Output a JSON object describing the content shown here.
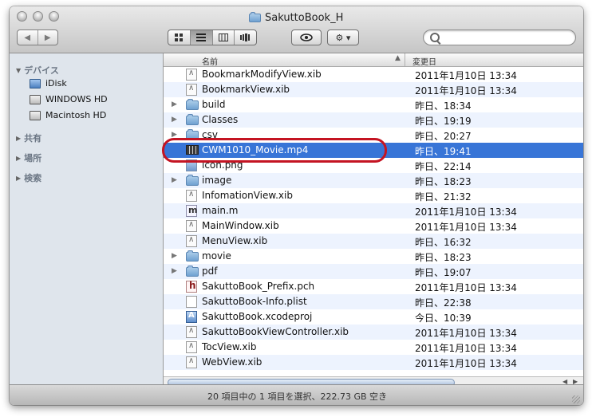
{
  "window": {
    "title": "SakuttoBook_H"
  },
  "toolbar": {
    "back_label": "◀",
    "forward_label": "▶",
    "view_modes": [
      "icon-view",
      "list-view",
      "column-view",
      "coverflow-view"
    ],
    "active_view": "list-view",
    "quicklook_label": "👁",
    "action_label": "⚙ ▾",
    "search_placeholder": ""
  },
  "sidebar": {
    "sections": [
      {
        "label": "デバイス",
        "expanded": true
      },
      {
        "label": "共有",
        "expanded": false
      },
      {
        "label": "場所",
        "expanded": false
      },
      {
        "label": "検索",
        "expanded": false
      }
    ],
    "devices": [
      {
        "label": "iDisk",
        "icon": "idisk-icon"
      },
      {
        "label": "WINDOWS HD",
        "icon": "hard-drive-icon"
      },
      {
        "label": "Macintosh HD",
        "icon": "hard-drive-icon"
      }
    ]
  },
  "columns": {
    "name": "名前",
    "modified": "変更日"
  },
  "files": [
    {
      "name": "BookmarkModifyView.xib",
      "date": "2011年1月10日 13:34",
      "type": "xib",
      "folder": false
    },
    {
      "name": "BookmarkView.xib",
      "date": "2011年1月10日 13:34",
      "type": "xib",
      "folder": false
    },
    {
      "name": "build",
      "date": "昨日、18:34",
      "type": "fold",
      "folder": true
    },
    {
      "name": "Classes",
      "date": "昨日、19:19",
      "type": "fold",
      "folder": true
    },
    {
      "name": "csv",
      "date": "昨日、20:27",
      "type": "fold",
      "folder": true
    },
    {
      "name": "CWM1010_Movie.mp4",
      "date": "昨日、19:41",
      "type": "movie",
      "folder": false,
      "selected": true
    },
    {
      "name": "icon.png",
      "date": "昨日、22:14",
      "type": "png",
      "folder": false
    },
    {
      "name": "image",
      "date": "昨日、18:23",
      "type": "fold",
      "folder": true
    },
    {
      "name": "InfomationView.xib",
      "date": "昨日、21:32",
      "type": "xib",
      "folder": false
    },
    {
      "name": "main.m",
      "date": "2011年1月10日 13:34",
      "type": "m",
      "folder": false
    },
    {
      "name": "MainWindow.xib",
      "date": "2011年1月10日 13:34",
      "type": "xib",
      "folder": false
    },
    {
      "name": "MenuView.xib",
      "date": "昨日、16:32",
      "type": "xib",
      "folder": false
    },
    {
      "name": "movie",
      "date": "昨日、18:23",
      "type": "fold",
      "folder": true
    },
    {
      "name": "pdf",
      "date": "昨日、19:07",
      "type": "fold",
      "folder": true
    },
    {
      "name": "SakuttoBook_Prefix.pch",
      "date": "2011年1月10日 13:34",
      "type": "h",
      "folder": false
    },
    {
      "name": "SakuttoBook-Info.plist",
      "date": "昨日、22:38",
      "type": "plist",
      "folder": false
    },
    {
      "name": "SakuttoBook.xcodeproj",
      "date": "今日、10:39",
      "type": "proj",
      "folder": false
    },
    {
      "name": "SakuttoBookViewController.xib",
      "date": "2011年1月10日 13:34",
      "type": "xib",
      "folder": false
    },
    {
      "name": "TocView.xib",
      "date": "2011年1月10日 13:34",
      "type": "xib",
      "folder": false
    },
    {
      "name": "WebView.xib",
      "date": "2011年1月10日 13:34",
      "type": "xib",
      "folder": false
    }
  ],
  "status": {
    "text": "20 項目中の 1 項目を選択、222.73 GB 空き"
  },
  "colors": {
    "selection": "#3875d7",
    "highlight_ring": "#c41422",
    "sidebar_bg": "#dfe5ec",
    "stripe": "#edf3fe"
  }
}
